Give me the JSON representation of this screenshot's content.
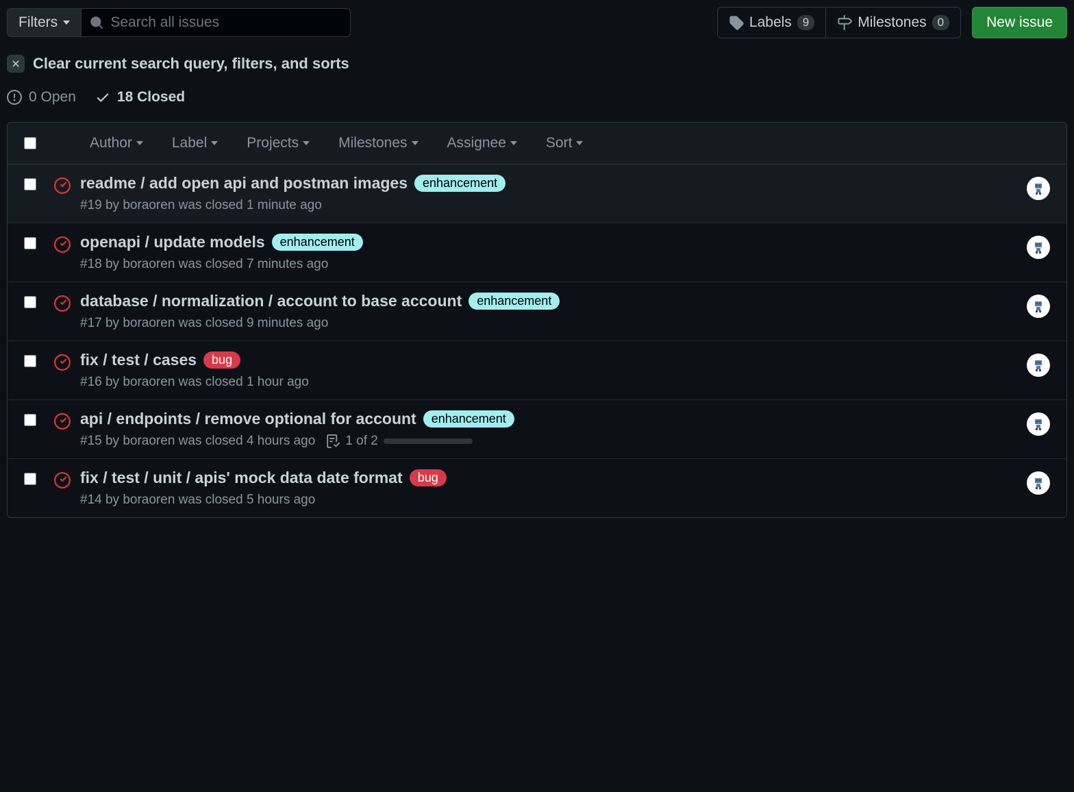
{
  "toolbar": {
    "filters_label": "Filters",
    "search_placeholder": "Search all issues",
    "labels_label": "Labels",
    "labels_count": "9",
    "milestones_label": "Milestones",
    "milestones_count": "0",
    "new_issue_label": "New issue"
  },
  "clear_text": "Clear current search query, filters, and sorts",
  "status": {
    "open_text": "0 Open",
    "closed_text": "18 Closed"
  },
  "table_filters": [
    "Author",
    "Label",
    "Projects",
    "Milestones",
    "Assignee",
    "Sort"
  ],
  "labels": {
    "enhancement": "enhancement",
    "bug": "bug"
  },
  "issues": [
    {
      "title": "readme / add open api and postman images",
      "label": "enhancement",
      "number": "#19",
      "author": "boraoren",
      "closed_text": "was closed 1 minute ago",
      "selected": true
    },
    {
      "title": "openapi / update models",
      "label": "enhancement",
      "number": "#18",
      "author": "boraoren",
      "closed_text": "was closed 7 minutes ago"
    },
    {
      "title": "database / normalization / account to base account",
      "label": "enhancement",
      "number": "#17",
      "author": "boraoren",
      "closed_text": "was closed 9 minutes ago"
    },
    {
      "title": "fix / test / cases",
      "label": "bug",
      "number": "#16",
      "author": "boraoren",
      "closed_text": "was closed 1 hour ago"
    },
    {
      "title": "api / endpoints / remove optional for account",
      "label": "enhancement",
      "number": "#15",
      "author": "boraoren",
      "closed_text": "was closed 4 hours ago",
      "tasks": {
        "text": "1 of 2",
        "progress": 50
      }
    },
    {
      "title": "fix / test / unit / apis' mock data date format",
      "label": "bug",
      "number": "#14",
      "author": "boraoren",
      "closed_text": "was closed 5 hours ago"
    }
  ]
}
